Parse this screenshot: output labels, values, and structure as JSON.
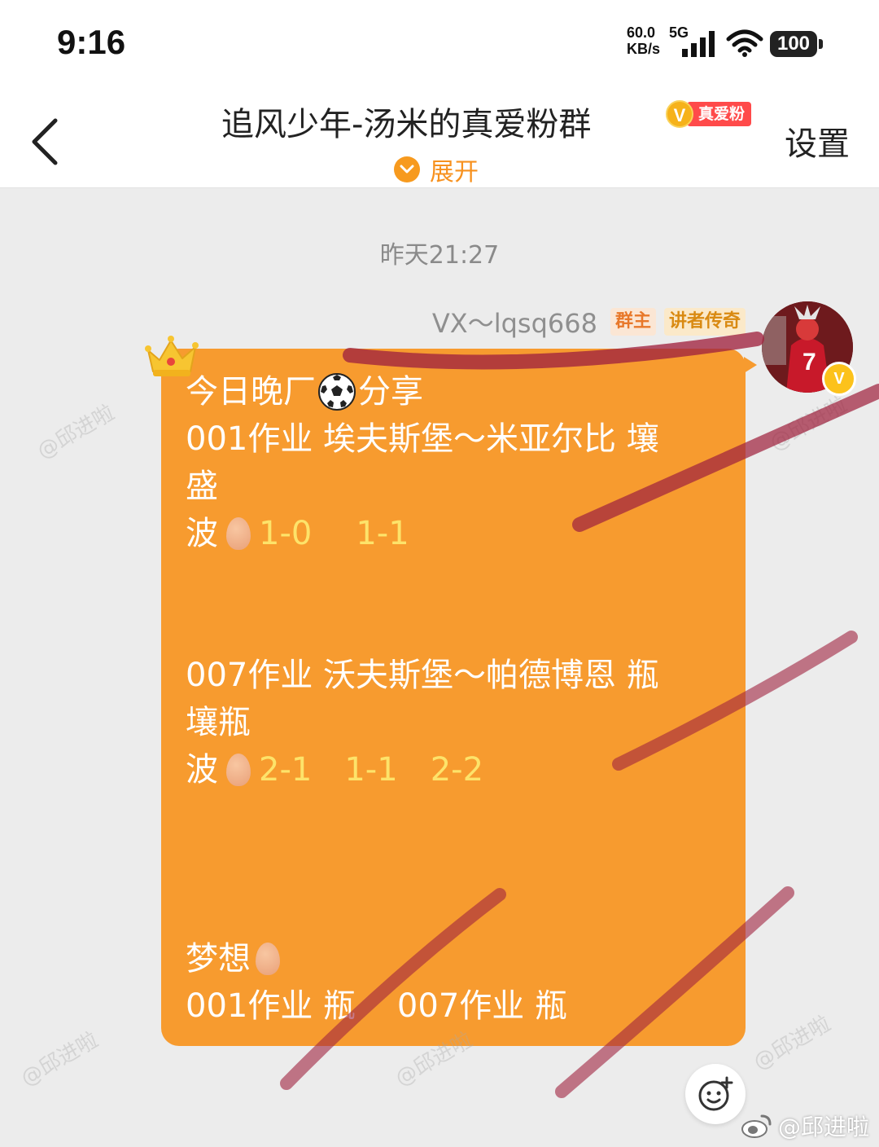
{
  "status_bar": {
    "time": "9:16",
    "net_speed_top": "60.0",
    "net_speed_bottom": "KB/s",
    "net_type": "5G",
    "battery": "100"
  },
  "header": {
    "title": "追风少年-汤米的真爱粉群",
    "fan_badge_letter": "V",
    "fan_badge_label": "真爱粉",
    "expand_label": "展开",
    "settings_label": "设置"
  },
  "chat": {
    "timestamp": "昨天21:27",
    "sender": {
      "name": "VX～lqsq668",
      "tags": [
        "群主",
        "讲者传奇"
      ],
      "verified_letter": "V"
    },
    "message": {
      "line1_before": "今日晚厂",
      "line1_after": "分享",
      "match1_line": "001作业 埃夫斯堡～米亚尔比  壤",
      "match1_cont": "盛",
      "match1_wave": "波",
      "match1_scores": [
        "1-0",
        "1-1"
      ],
      "match2_line": "007作业 沃夫斯堡～帕德博恩  瓶",
      "match2_cont": "壤瓶",
      "match2_wave": "波",
      "match2_scores": [
        "2-1",
        "1-1",
        "2-2"
      ],
      "dream_label": "梦想",
      "dream_line": "001作业 瓶    007作业 瓶"
    }
  },
  "watermarks": {
    "text": "@邱进啦",
    "weibo": "@邱进啦"
  },
  "colors": {
    "bubble": "#f79b2f",
    "accent": "#f7911e",
    "score": "#fde36a",
    "scribble": "#a0233f"
  },
  "icons": [
    "back-icon",
    "chevron-down-icon",
    "crown-icon",
    "soccer-ball-icon",
    "egg-icon",
    "emoji-add-icon",
    "weibo-logo-icon"
  ]
}
